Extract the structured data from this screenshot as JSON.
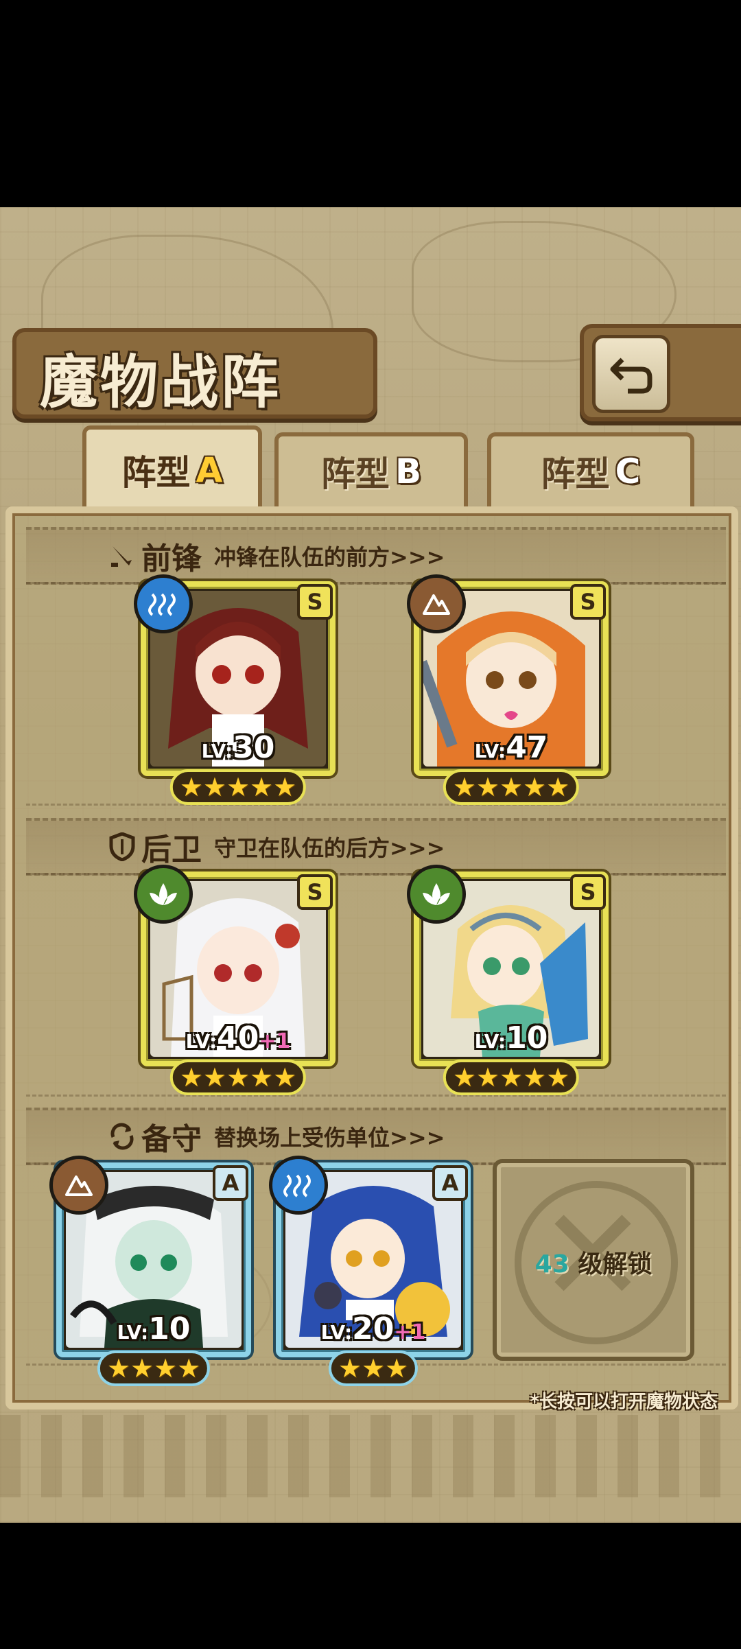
{
  "title": "魔物战阵",
  "tabs": [
    {
      "name": "阵型",
      "letter": "A",
      "active": true
    },
    {
      "name": "阵型",
      "letter": "B",
      "active": false
    },
    {
      "name": "阵型",
      "letter": "C",
      "active": false
    }
  ],
  "sections": {
    "front": {
      "name": "前锋",
      "desc": "冲锋在队伍的前方>>>",
      "icon": "sword-icon"
    },
    "rear": {
      "name": "后卫",
      "desc": "守卫在队伍的后方>>>",
      "icon": "shield-icon"
    },
    "reserve": {
      "name": "备守",
      "desc": "替换场上受伤单位>>>",
      "icon": "swap-icon"
    }
  },
  "units": {
    "front1": {
      "element": "water-icon",
      "rank": "S",
      "lv_tag": "LV:",
      "level": "30",
      "plus": "",
      "stars": "★★★★★"
    },
    "front2": {
      "element": "earth-icon",
      "rank": "S",
      "lv_tag": "LV:",
      "level": "47",
      "plus": "",
      "stars": "★★★★★"
    },
    "rear1": {
      "element": "leaf-icon",
      "rank": "S",
      "lv_tag": "LV:",
      "level": "40",
      "plus": "+1",
      "stars": "★★★★★"
    },
    "rear2": {
      "element": "leaf-icon",
      "rank": "S",
      "lv_tag": "LV:",
      "level": "10",
      "plus": "",
      "stars": "★★★★★"
    },
    "reserve1": {
      "element": "earth-icon",
      "rank": "A",
      "lv_tag": "LV:",
      "level": "10",
      "plus": "",
      "stars": "★★★★"
    },
    "reserve2": {
      "element": "water-icon",
      "rank": "A",
      "lv_tag": "LV:",
      "level": "20",
      "plus": "+1",
      "stars": "★★★"
    }
  },
  "locked_slot": {
    "level": "43",
    "label": "级解锁"
  },
  "hint": "*长按可以打开魔物状态",
  "colors": {
    "card_s_border": "#e8e155",
    "card_a_border": "#8ed3e8",
    "star": "#ffcf2e",
    "plus": "#f06ab5"
  }
}
